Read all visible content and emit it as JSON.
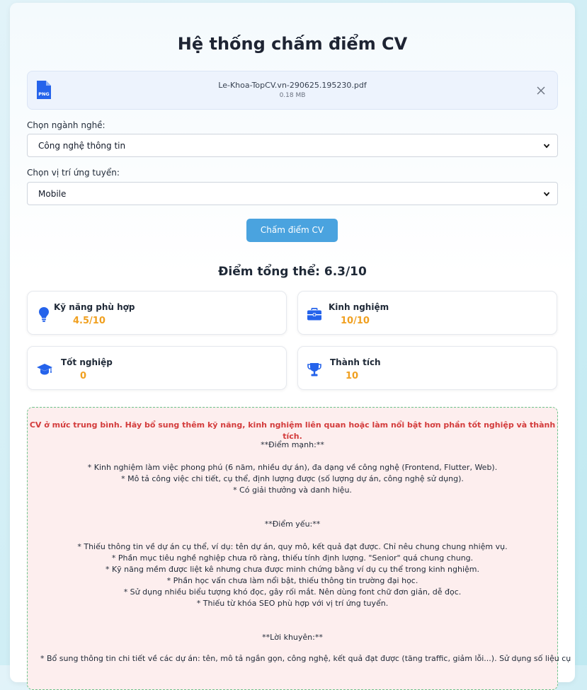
{
  "page": {
    "title": "Hệ thống chấm điểm CV"
  },
  "file": {
    "icon": "png-file-icon",
    "name": "Le-Khoa-TopCV.vn-290625.195230.pdf",
    "size": "0.18 MB",
    "close_icon": "close-icon"
  },
  "form": {
    "industry_label": "Chọn ngành nghề:",
    "industry_value": "Công nghệ thông tin",
    "position_label": "Chọn vị trí ứng tuyển:",
    "position_value": "Mobile",
    "submit_label": "Chấm điểm CV"
  },
  "result": {
    "overall": "Điểm tổng thể: 6.3/10",
    "metrics": [
      {
        "label": "Kỹ năng phù hợp",
        "value": "4.5/10",
        "icon": "lightbulb-icon"
      },
      {
        "label": "Kinh nghiệm",
        "value": "10/10",
        "icon": "briefcase-icon"
      },
      {
        "label": "Tốt nghiệp",
        "value": "0",
        "icon": "graduation-cap-icon"
      },
      {
        "label": "Thành tích",
        "value": "10",
        "icon": "trophy-icon"
      }
    ]
  },
  "feedback": {
    "summary": "CV ở mức trung bình. Hãy bổ sung thêm kỹ năng, kinh nghiệm liên quan hoặc làm nổi bật hơn phần tốt nghiệp và thành tích.",
    "lines": [
      "**Điểm mạnh:**",
      "* Kinh nghiệm làm việc phong phú (6 năm, nhiều dự án), đa dạng về công nghệ (Frontend, Flutter, Web).",
      "* Mô tả công việc chi tiết, cụ thể, định lượng được (số lượng dự án, công nghệ sử dụng).",
      "* Có giải thưởng và danh hiệu.",
      "**Điểm yếu:**",
      "* Thiếu thông tin về dự án cụ thể, ví dụ: tên dự án, quy mô, kết quả đạt được. Chỉ nêu chung chung nhiệm vụ.",
      "* Phần mục tiêu nghề nghiệp chưa rõ ràng, thiếu tính định lượng. \"Senior\" quá chung chung.",
      "* Kỹ năng mềm được liệt kê nhưng chưa được minh chứng bằng ví dụ cụ thể trong kinh nghiệm.",
      "* Phần học vấn chưa làm nổi bật, thiếu thông tin trường đại học.",
      "* Sử dụng nhiều biểu tượng khó đọc, gây rối mắt. Nên dùng font chữ đơn giản, dễ đọc.",
      "* Thiếu từ khóa SEO phù hợp với vị trí ứng tuyển.",
      "**Lời khuyên:**",
      "* Bổ sung thông tin chi tiết về các dự án: tên, mô tả ngắn gọn, công nghệ, kết quả đạt được (tăng traffic, giảm lỗi...). Sử dụng số liệu cụ"
    ]
  },
  "colors": {
    "accent": "#4aa3df",
    "score": "#f0a020",
    "icon_blue": "#2563eb",
    "summary_red": "#d33b3b"
  }
}
